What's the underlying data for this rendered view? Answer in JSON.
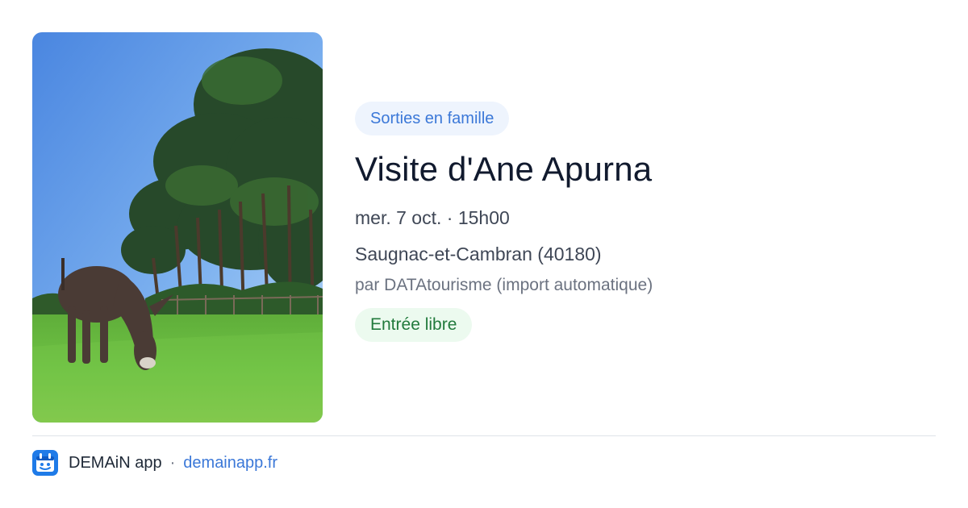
{
  "event": {
    "image_alt": "Âne broutant dans un pré",
    "category": "Sorties en famille",
    "title": "Visite d'Ane Apurna",
    "datetime": "mer. 7 oct. · 15h00",
    "location": "Saugnac-et-Cambran (40180)",
    "organizer": "par DATAtourisme (import automatique)",
    "price": "Entrée libre"
  },
  "footer": {
    "app_name": "DEMAiN app",
    "separator": "·",
    "link": "demainapp.fr"
  },
  "colors": {
    "accent": "#3b78d8",
    "category_bg": "#eef4fd",
    "price_text": "#217a3c",
    "price_bg": "#ecfaef",
    "title": "#111a2e"
  }
}
